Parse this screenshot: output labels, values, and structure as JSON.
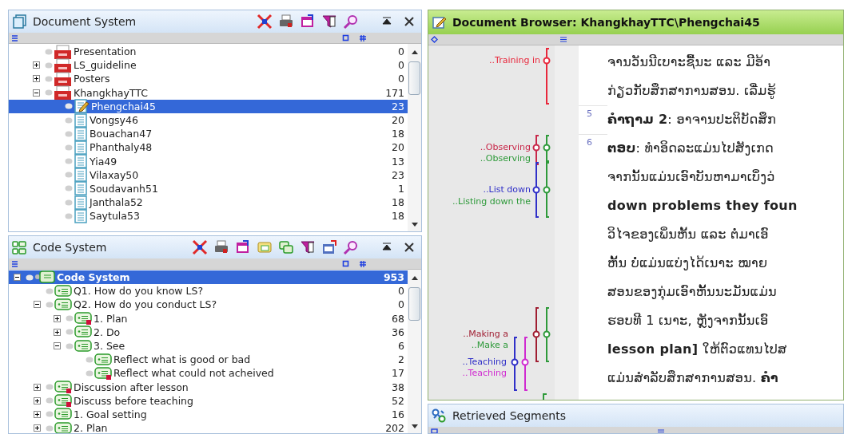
{
  "document_system": {
    "title": "Document System",
    "items": [
      {
        "label": "Presentation",
        "count": "0",
        "kind": "set"
      },
      {
        "label": "LS_guideline",
        "count": "0",
        "kind": "set",
        "expanded": false
      },
      {
        "label": "Posters",
        "count": "0",
        "kind": "set",
        "expanded": false
      },
      {
        "label": "KhangkhayTTC",
        "count": "171",
        "kind": "set",
        "expanded": true,
        "children": [
          {
            "label": "Phengchai45",
            "count": "23",
            "kind": "open",
            "selected": true
          },
          {
            "label": "Vongsy46",
            "count": "20",
            "kind": "text",
            "selected": false
          },
          {
            "label": "Bouachan47",
            "count": "18",
            "kind": "text",
            "selected": false
          },
          {
            "label": "Phanthaly48",
            "count": "20",
            "kind": "text",
            "selected": false
          },
          {
            "label": "Yia49",
            "count": "13",
            "kind": "text",
            "selected": false
          },
          {
            "label": "Vilaxay50",
            "count": "23",
            "kind": "text",
            "selected": false
          },
          {
            "label": "Soudavanh51",
            "count": "1",
            "kind": "text",
            "selected": false
          },
          {
            "label": "Janthala52",
            "count": "18",
            "kind": "text",
            "selected": false
          },
          {
            "label": "Saytula53",
            "count": "18",
            "kind": "text",
            "selected": false
          }
        ]
      }
    ]
  },
  "code_system": {
    "title": "Code System",
    "items": [
      {
        "label": "Code System",
        "count": "953",
        "kind": "root",
        "selected": true,
        "expanded": true,
        "children": [
          {
            "label": "Q1. How do you know LS?",
            "count": "0",
            "kind": "code",
            "memo": false,
            "selected": false
          },
          {
            "label": "Q2. How do you conduct LS?",
            "count": "0",
            "kind": "code",
            "memo": false,
            "selected": false,
            "expanded": true,
            "children": [
              {
                "label": "1. Plan",
                "count": "68",
                "kind": "code",
                "memo": true,
                "selected": false,
                "expanded": false
              },
              {
                "label": "2. Do",
                "count": "36",
                "kind": "code",
                "memo": false,
                "selected": false,
                "expanded": false
              },
              {
                "label": "3. See",
                "count": "6",
                "kind": "code",
                "memo": false,
                "selected": false,
                "expanded": true,
                "children": [
                  {
                    "label": "Reflect what is good or bad",
                    "count": "2",
                    "kind": "code",
                    "memo": false,
                    "selected": false
                  },
                  {
                    "label": "Reflect what could not acheived",
                    "count": "17",
                    "kind": "code",
                    "memo": true,
                    "selected": false
                  }
                ]
              }
            ]
          },
          {
            "label": "Discussion after lesson",
            "count": "38",
            "kind": "code",
            "memo": true,
            "selected": false,
            "expanded": false
          },
          {
            "label": "Discuss before teaching",
            "count": "52",
            "kind": "code",
            "memo": true,
            "selected": false,
            "expanded": false
          },
          {
            "label": "1. Goal setting",
            "count": "16",
            "kind": "code",
            "memo": false,
            "selected": false,
            "expanded": false
          },
          {
            "label": "2. Plan",
            "count": "202",
            "kind": "code",
            "memo": false,
            "selected": false,
            "expanded": false
          }
        ]
      }
    ]
  },
  "document_browser": {
    "title": "Document Browser: KhangkhayTTC\\Phengchai45",
    "codings": [
      {
        "label": "..Training in",
        "color": "#e8283c"
      },
      {
        "label": "..Observing",
        "color": "#c8284a"
      },
      {
        "label": "..Observing",
        "color": "#2e9a3a"
      },
      {
        "label": "..List down",
        "color": "#3030c8"
      },
      {
        "label": "..Listing down the",
        "color": "#2e9a3a"
      },
      {
        "label": "..Making a",
        "color": "#a01e32"
      },
      {
        "label": "..Make a",
        "color": "#2e9a3a"
      },
      {
        "label": "..Teaching",
        "color": "#3030c8"
      },
      {
        "label": "..Teaching",
        "color": "#d02ad0"
      }
    ],
    "lines": [
      {
        "text": "ຈານວັນນີເບາະຊື້ນະ ແລະ ມີອ້າ"
      },
      {
        "text": "ກ່ຽວກັບສຶກສາການສອນ. ເລີ່ມຮູ້"
      },
      {
        "number": "5",
        "text": "**ຄຳຖາມ 2**: ອາຈານປະຕິບັດສຶກ"
      },
      {
        "number": "6",
        "text": "**ຕອບ**: ທຳອິດລະແມ່ນໄປສັງເກດ"
      },
      {
        "text": "ຈາກນັ້ນແມ່ນເອົາບັນຫາມາເບິ່ງວ່"
      },
      {
        "text": "**down problems they foun**"
      },
      {
        "text": "ວິໄຈຂອງເພິ່ນຫັ້ນ ແລະ ຕໍ່ມາເອົ"
      },
      {
        "text": "ຫັ້ນ ບໍ່ແມ່ນແບ່ງໄດ້ເນາະ ໝາຍ"
      },
      {
        "text": "ສອນຂອງກຸ່ມເອົາຫັ້ນນະມັນແມ່ນ"
      },
      {
        "text": "ຮອບທີ 1 ເນາະ, ຫຼັງຈາກນັ້ນເອົ"
      },
      {
        "text": "**lesson plan]** ໃຫ້ຕົວແທນໄປສ"
      },
      {
        "text": "ແມ່ນສຳລັບສຶກສາການສອນ. **ຄຳ**"
      }
    ]
  },
  "retrieved_segments": {
    "title": "Retrieved Segments"
  }
}
